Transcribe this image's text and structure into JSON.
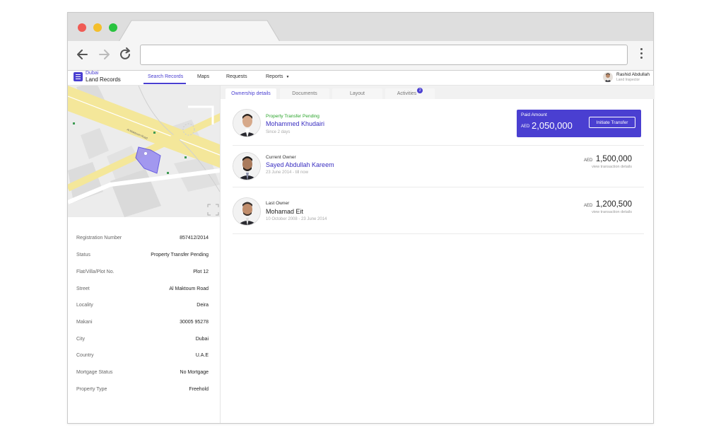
{
  "app": {
    "brand_line1": "Dubai",
    "brand_line2": "Land Records",
    "accent_color": "#4a3fd1"
  },
  "nav": [
    {
      "label": "Search Records",
      "active": true
    },
    {
      "label": "Maps"
    },
    {
      "label": "Requests"
    },
    {
      "label": "Reports"
    }
  ],
  "user": {
    "name": "Rashid Abdullah",
    "role": "Land Inspector"
  },
  "details": [
    {
      "label": "Registration Number",
      "value": "857412/2014"
    },
    {
      "label": "Status",
      "value": "Property Transfer Pending"
    },
    {
      "label": "Flat/Villa/Plot No.",
      "value": "Plot 12"
    },
    {
      "label": "Street",
      "value": "Al Maktoum Road"
    },
    {
      "label": "Locality",
      "value": "Deira"
    },
    {
      "label": "Makani",
      "value": "30005 95278"
    },
    {
      "label": "City",
      "value": "Dubai"
    },
    {
      "label": "Country",
      "value": "U.A.E"
    },
    {
      "label": "Mortgage Status",
      "value": "No Mortgage"
    },
    {
      "label": "Property Type",
      "value": "Freehold"
    }
  ],
  "map": {
    "road_label": "Al Maktoum Road"
  },
  "tabs": [
    {
      "label": "Ownership details",
      "active": true
    },
    {
      "label": "Documents"
    },
    {
      "label": "Layout"
    },
    {
      "label": "Activities",
      "badge": "2"
    }
  ],
  "owners": [
    {
      "kicker": "Property Transfer Pending",
      "name": "Mohammed Khudairi",
      "sub": "Since 2 days",
      "paid_label": "Paid Amount",
      "currency": "AED",
      "amount": "2,050,000",
      "action_label": "Initiate Transfer"
    },
    {
      "kicker": "Current Owner",
      "name": "Sayed Abdullah Kareem",
      "sub": "23 June 2014 - till now",
      "currency": "AED",
      "amount": "1,500,000",
      "link": "view transaction details"
    },
    {
      "kicker": "Last Owner",
      "name": "Mohamad Eit",
      "sub": "10 October 2008 - 23 June 2014",
      "currency": "AED",
      "amount": "1,200,500",
      "link": "view transaction details"
    }
  ]
}
